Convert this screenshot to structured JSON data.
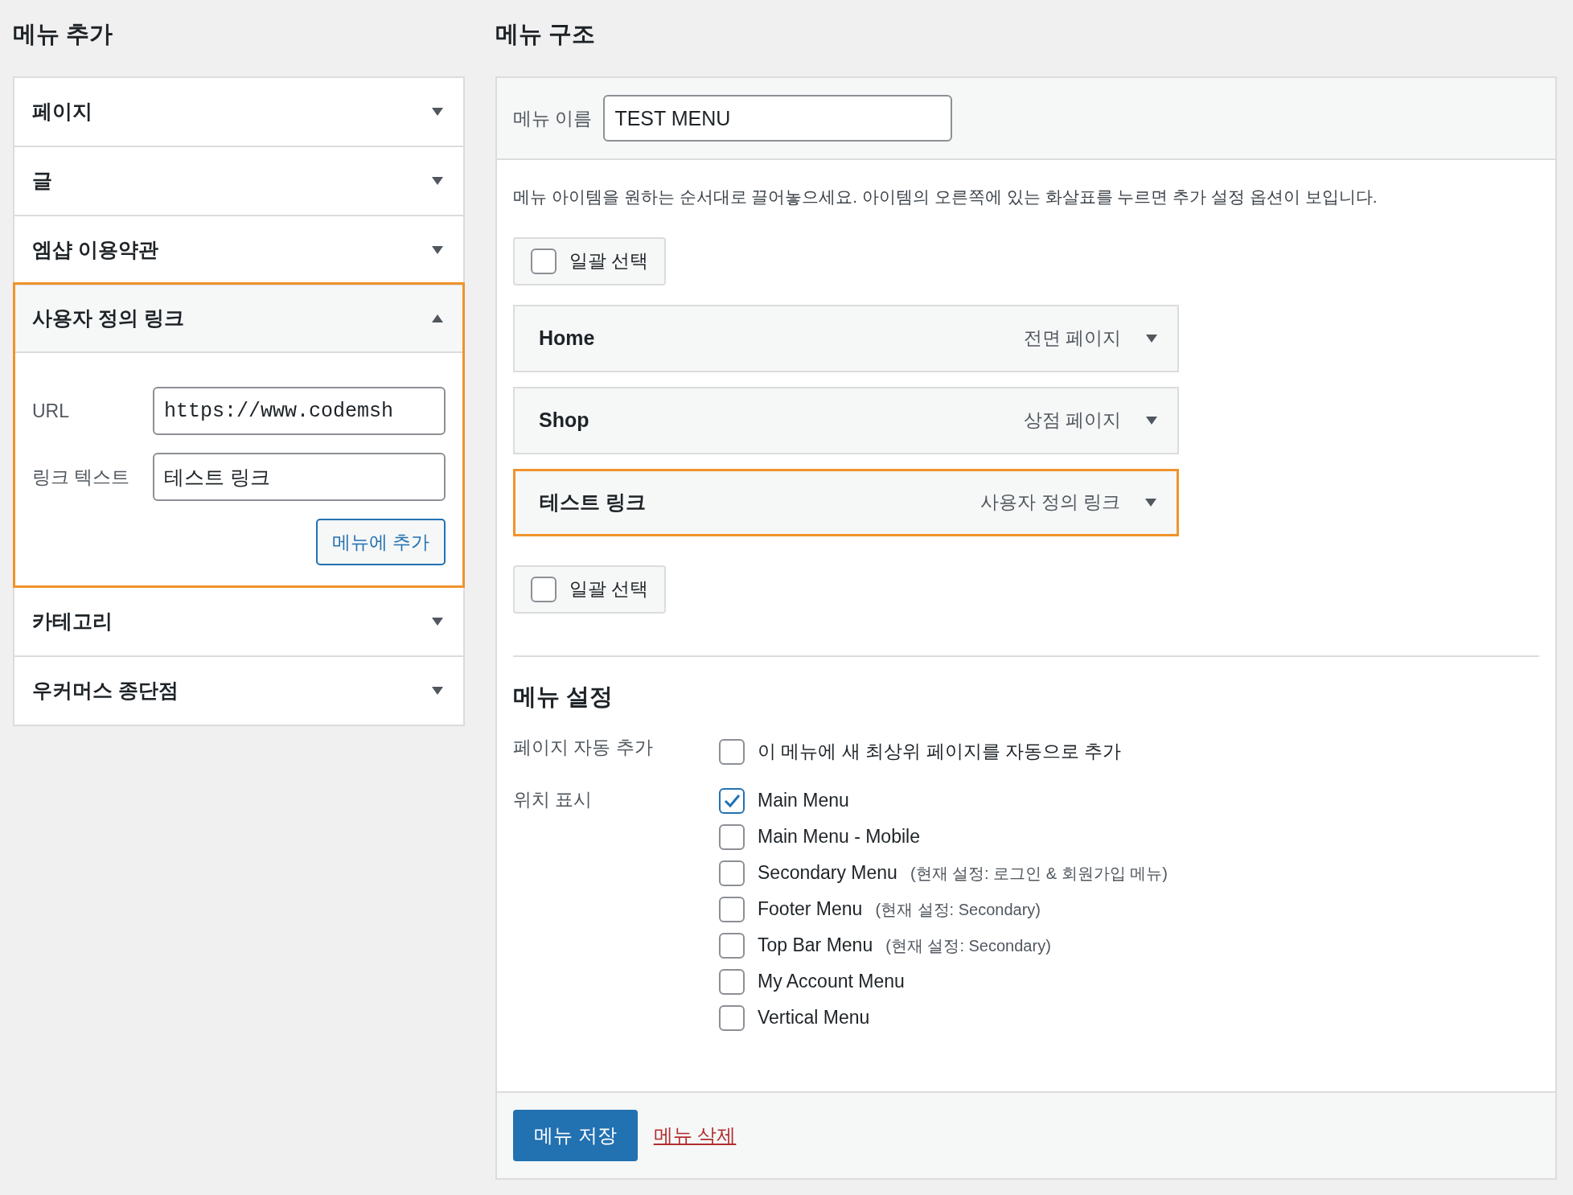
{
  "add_menu": {
    "title": "메뉴 추가",
    "sections": [
      {
        "label": "페이지",
        "expanded": false,
        "highlighted": false
      },
      {
        "label": "글",
        "expanded": false,
        "highlighted": false
      },
      {
        "label": "엠샵 이용약관",
        "expanded": false,
        "highlighted": false
      },
      {
        "label": "사용자 정의 링크",
        "expanded": true,
        "highlighted": true,
        "url_label": "URL",
        "url_value": "https://www.codemsh",
        "link_text_label": "링크 텍스트",
        "link_text_value": "테스트 링크",
        "button": "메뉴에 추가"
      },
      {
        "label": "카테고리",
        "expanded": false,
        "highlighted": false
      },
      {
        "label": "우커머스 종단점",
        "expanded": false,
        "highlighted": false
      }
    ]
  },
  "menu_structure": {
    "title": "메뉴 구조",
    "name_label": "메뉴 이름",
    "name_value": "TEST MENU",
    "instructions": "메뉴 아이템을 원하는 순서대로 끌어놓으세요. 아이템의 오른쪽에 있는 화살표를 누르면 추가 설정 옵션이 보입니다.",
    "bulk_select_top": {
      "label": "일괄 선택",
      "checked": false
    },
    "items": [
      {
        "title": "Home",
        "type": "전면 페이지",
        "highlighted": false
      },
      {
        "title": "Shop",
        "type": "상점 페이지",
        "highlighted": false
      },
      {
        "title": "테스트 링크",
        "type": "사용자 정의 링크",
        "highlighted": true
      }
    ],
    "bulk_select_bottom": {
      "label": "일괄 선택",
      "checked": false
    },
    "settings": {
      "title": "메뉴 설정",
      "auto_add_label": "페이지 자동 추가",
      "auto_add": {
        "label": "이 메뉴에 새 최상위 페이지를 자동으로 추가",
        "checked": false
      },
      "locations_label": "위치 표시",
      "locations": [
        {
          "name": "Main Menu",
          "checked": true
        },
        {
          "name": "Main Menu - Mobile",
          "checked": false
        },
        {
          "name": "Secondary Menu",
          "note": "(현재 설정: 로그인 & 회원가입 메뉴)",
          "checked": false
        },
        {
          "name": "Footer Menu",
          "note": "(현재 설정: Secondary)",
          "checked": false
        },
        {
          "name": "Top Bar Menu",
          "note": "(현재 설정: Secondary)",
          "checked": false
        },
        {
          "name": "My Account Menu",
          "checked": false
        },
        {
          "name": "Vertical Menu",
          "checked": false
        }
      ]
    },
    "save_button": "메뉴 저장",
    "delete_link": "메뉴 삭제"
  }
}
